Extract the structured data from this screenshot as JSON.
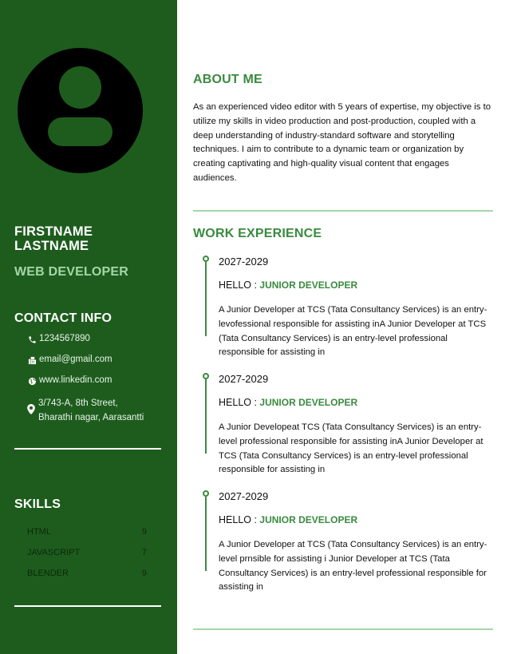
{
  "profile": {
    "first_name": "FIRSTNAME",
    "last_name": "LASTNAME",
    "role": "WEB DEVELOPER"
  },
  "contact": {
    "heading": "CONTACT INFO",
    "phone": "1234567890",
    "email": "email@gmail.com",
    "website": "www.linkedin.com",
    "address_line1": "3/743-A, 8th Street,",
    "address_line2": "Bharathi nagar, Aarasantti"
  },
  "skills": {
    "heading": "SKILLS",
    "items": [
      {
        "name": "HTML",
        "level": "9"
      },
      {
        "name": "JAVASCRIPT",
        "level": "7"
      },
      {
        "name": "BLENDER",
        "level": "9"
      }
    ]
  },
  "about": {
    "heading": "ABOUT ME",
    "text": "As an experienced video editor with 5 years of expertise, my objective is to utilize my skills in video production and post-production, coupled with a deep understanding of industry-standard software and storytelling techniques. I aim to contribute to a dynamic team or organization by creating captivating and high-quality visual content that engages audiences."
  },
  "experience": {
    "heading": "WORK EXPERIENCE",
    "jobs": [
      {
        "years": "2027-2029",
        "prefix": "HELLO : ",
        "title": "JUNIOR DEVELOPER",
        "description": "A Junior Developer at TCS (Tata Consultancy Services) is an entry-levofessional responsible for assisting inA Junior Developer at TCS (Tata Consultancy Services) is an entry-level professional responsible for assisting in"
      },
      {
        "years": "2027-2029",
        "prefix": "HELLO : ",
        "title": "JUNIOR DEVELOPER",
        "description": "A Junior Developeat TCS (Tata Consultancy Services) is an entry-level professional responsible for assisting inA Junior Developer at TCS (Tata Consultancy Services) is an entry-level professional responsible for assisting in"
      },
      {
        "years": "2027-2029",
        "prefix": "HELLO : ",
        "title": "JUNIOR DEVELOPER",
        "description": "A Junior Developer at TCS (Tata Consultancy Services) is an entry-level prnsible for assisting i Junior Developer at TCS (Tata Consultancy Services) is an entry-level professional responsible for assisting in"
      }
    ]
  },
  "colors": {
    "sidebar": "#1e5c1e",
    "accent": "#3a8a3f",
    "light_accent": "#a5d6a7"
  },
  "icons": [
    "avatar-icon",
    "phone-icon",
    "fax-icon",
    "globe-icon",
    "map-pin-icon"
  ]
}
